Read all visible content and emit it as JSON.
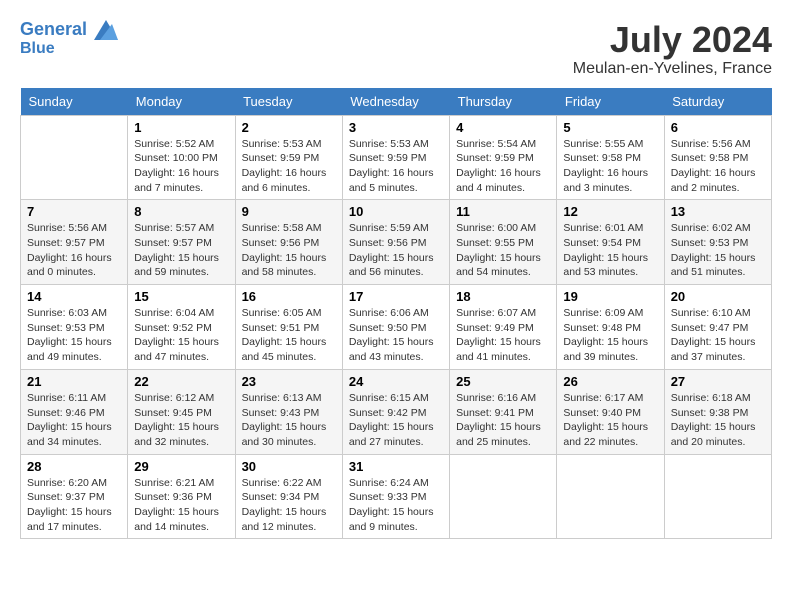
{
  "header": {
    "logo_line1": "General",
    "logo_line2": "Blue",
    "month_year": "July 2024",
    "location": "Meulan-en-Yvelines, France"
  },
  "days_of_week": [
    "Sunday",
    "Monday",
    "Tuesday",
    "Wednesday",
    "Thursday",
    "Friday",
    "Saturday"
  ],
  "weeks": [
    [
      {
        "day": "",
        "info": ""
      },
      {
        "day": "1",
        "info": "Sunrise: 5:52 AM\nSunset: 10:00 PM\nDaylight: 16 hours\nand 7 minutes."
      },
      {
        "day": "2",
        "info": "Sunrise: 5:53 AM\nSunset: 9:59 PM\nDaylight: 16 hours\nand 6 minutes."
      },
      {
        "day": "3",
        "info": "Sunrise: 5:53 AM\nSunset: 9:59 PM\nDaylight: 16 hours\nand 5 minutes."
      },
      {
        "day": "4",
        "info": "Sunrise: 5:54 AM\nSunset: 9:59 PM\nDaylight: 16 hours\nand 4 minutes."
      },
      {
        "day": "5",
        "info": "Sunrise: 5:55 AM\nSunset: 9:58 PM\nDaylight: 16 hours\nand 3 minutes."
      },
      {
        "day": "6",
        "info": "Sunrise: 5:56 AM\nSunset: 9:58 PM\nDaylight: 16 hours\nand 2 minutes."
      }
    ],
    [
      {
        "day": "7",
        "info": "Sunrise: 5:56 AM\nSunset: 9:57 PM\nDaylight: 16 hours\nand 0 minutes."
      },
      {
        "day": "8",
        "info": "Sunrise: 5:57 AM\nSunset: 9:57 PM\nDaylight: 15 hours\nand 59 minutes."
      },
      {
        "day": "9",
        "info": "Sunrise: 5:58 AM\nSunset: 9:56 PM\nDaylight: 15 hours\nand 58 minutes."
      },
      {
        "day": "10",
        "info": "Sunrise: 5:59 AM\nSunset: 9:56 PM\nDaylight: 15 hours\nand 56 minutes."
      },
      {
        "day": "11",
        "info": "Sunrise: 6:00 AM\nSunset: 9:55 PM\nDaylight: 15 hours\nand 54 minutes."
      },
      {
        "day": "12",
        "info": "Sunrise: 6:01 AM\nSunset: 9:54 PM\nDaylight: 15 hours\nand 53 minutes."
      },
      {
        "day": "13",
        "info": "Sunrise: 6:02 AM\nSunset: 9:53 PM\nDaylight: 15 hours\nand 51 minutes."
      }
    ],
    [
      {
        "day": "14",
        "info": "Sunrise: 6:03 AM\nSunset: 9:53 PM\nDaylight: 15 hours\nand 49 minutes."
      },
      {
        "day": "15",
        "info": "Sunrise: 6:04 AM\nSunset: 9:52 PM\nDaylight: 15 hours\nand 47 minutes."
      },
      {
        "day": "16",
        "info": "Sunrise: 6:05 AM\nSunset: 9:51 PM\nDaylight: 15 hours\nand 45 minutes."
      },
      {
        "day": "17",
        "info": "Sunrise: 6:06 AM\nSunset: 9:50 PM\nDaylight: 15 hours\nand 43 minutes."
      },
      {
        "day": "18",
        "info": "Sunrise: 6:07 AM\nSunset: 9:49 PM\nDaylight: 15 hours\nand 41 minutes."
      },
      {
        "day": "19",
        "info": "Sunrise: 6:09 AM\nSunset: 9:48 PM\nDaylight: 15 hours\nand 39 minutes."
      },
      {
        "day": "20",
        "info": "Sunrise: 6:10 AM\nSunset: 9:47 PM\nDaylight: 15 hours\nand 37 minutes."
      }
    ],
    [
      {
        "day": "21",
        "info": "Sunrise: 6:11 AM\nSunset: 9:46 PM\nDaylight: 15 hours\nand 34 minutes."
      },
      {
        "day": "22",
        "info": "Sunrise: 6:12 AM\nSunset: 9:45 PM\nDaylight: 15 hours\nand 32 minutes."
      },
      {
        "day": "23",
        "info": "Sunrise: 6:13 AM\nSunset: 9:43 PM\nDaylight: 15 hours\nand 30 minutes."
      },
      {
        "day": "24",
        "info": "Sunrise: 6:15 AM\nSunset: 9:42 PM\nDaylight: 15 hours\nand 27 minutes."
      },
      {
        "day": "25",
        "info": "Sunrise: 6:16 AM\nSunset: 9:41 PM\nDaylight: 15 hours\nand 25 minutes."
      },
      {
        "day": "26",
        "info": "Sunrise: 6:17 AM\nSunset: 9:40 PM\nDaylight: 15 hours\nand 22 minutes."
      },
      {
        "day": "27",
        "info": "Sunrise: 6:18 AM\nSunset: 9:38 PM\nDaylight: 15 hours\nand 20 minutes."
      }
    ],
    [
      {
        "day": "28",
        "info": "Sunrise: 6:20 AM\nSunset: 9:37 PM\nDaylight: 15 hours\nand 17 minutes."
      },
      {
        "day": "29",
        "info": "Sunrise: 6:21 AM\nSunset: 9:36 PM\nDaylight: 15 hours\nand 14 minutes."
      },
      {
        "day": "30",
        "info": "Sunrise: 6:22 AM\nSunset: 9:34 PM\nDaylight: 15 hours\nand 12 minutes."
      },
      {
        "day": "31",
        "info": "Sunrise: 6:24 AM\nSunset: 9:33 PM\nDaylight: 15 hours\nand 9 minutes."
      },
      {
        "day": "",
        "info": ""
      },
      {
        "day": "",
        "info": ""
      },
      {
        "day": "",
        "info": ""
      }
    ]
  ]
}
